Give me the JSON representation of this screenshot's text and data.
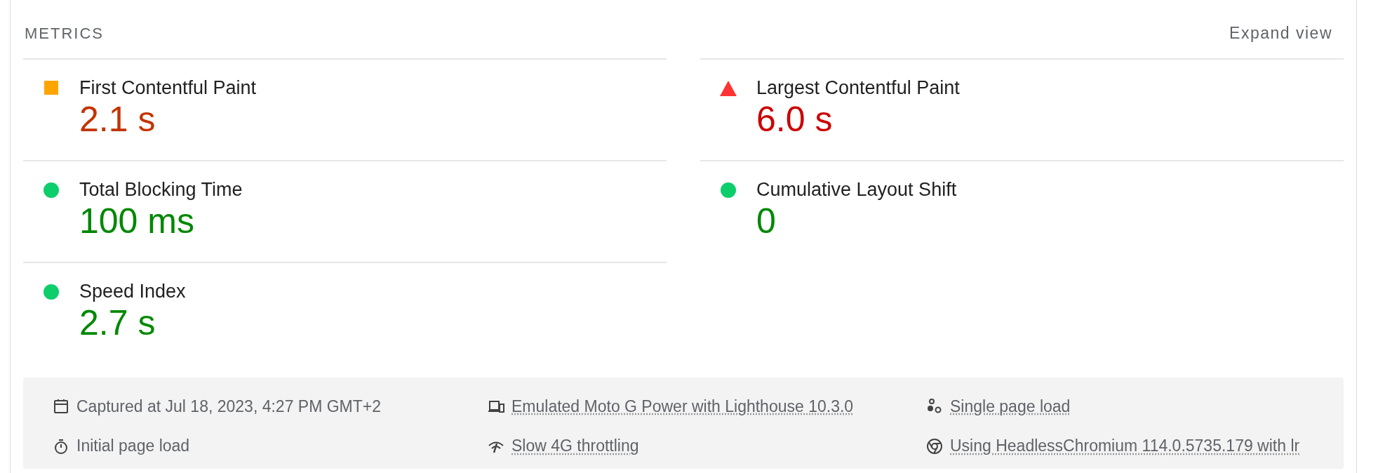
{
  "section": {
    "title": "METRICS",
    "action": "Expand view"
  },
  "metrics": [
    {
      "label": "First Contentful Paint",
      "value": "2.1 s",
      "kind": "average"
    },
    {
      "label": "Largest Contentful Paint",
      "value": "6.0 s",
      "kind": "fail"
    },
    {
      "label": "Total Blocking Time",
      "value": "100 ms",
      "kind": "pass"
    },
    {
      "label": "Cumulative Layout Shift",
      "value": "0",
      "kind": "pass"
    },
    {
      "label": "Speed Index",
      "value": "2.7 s",
      "kind": "pass"
    }
  ],
  "run_info": [
    {
      "kind": "calendar",
      "text": "Captured at Jul 18, 2023, 4:27 PM GMT+2",
      "link": false
    },
    {
      "kind": "devices",
      "text": "Emulated Moto G Power with Lighthouse 10.3.0",
      "link": true
    },
    {
      "kind": "circles",
      "text": "Single page load",
      "link": true
    },
    {
      "kind": "stopwatch",
      "text": "Initial page load",
      "link": false
    },
    {
      "kind": "signal",
      "text": "Slow 4G throttling",
      "link": true
    },
    {
      "kind": "browser",
      "text": "Using HeadlessChromium 114.0.5735.179 with lr",
      "link": true
    }
  ]
}
